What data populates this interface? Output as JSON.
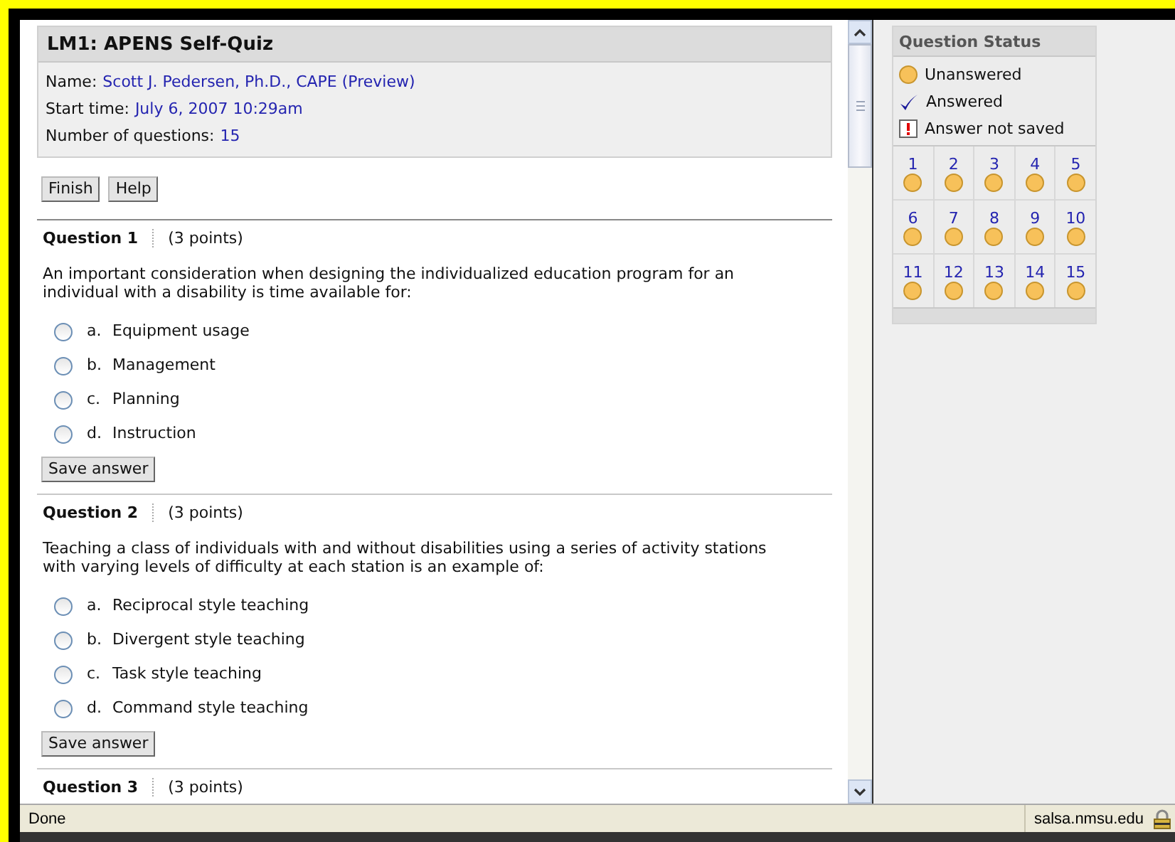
{
  "quiz": {
    "title": "LM1: APENS Self-Quiz",
    "info": [
      {
        "label": "Name:",
        "value": "Scott J. Pedersen, Ph.D., CAPE (Preview)"
      },
      {
        "label": "Start time:",
        "value": "July 6, 2007 10:29am"
      },
      {
        "label": "Number of questions:",
        "value": "15"
      }
    ],
    "buttons": [
      "Finish",
      "Help"
    ],
    "questions": [
      {
        "heading": "Question 1",
        "points": "(3 points)",
        "text": "An important consideration when designing the individualized education program for an individual with a disability is time available for:",
        "options": [
          {
            "label": "a.",
            "text": "Equipment usage",
            "selected": false
          },
          {
            "label": "b.",
            "text": "Management",
            "selected": false
          },
          {
            "label": "c.",
            "text": "Planning",
            "selected": false
          },
          {
            "label": "d.",
            "text": "Instruction",
            "selected": false
          }
        ],
        "save_button": "Save answer"
      },
      {
        "heading": "Question 2",
        "points": "(3 points)",
        "text": "Teaching a class of individuals with and without disabilities using a series of activity stations with varying levels of difficulty at each station is an example of:",
        "options": [
          {
            "label": "a.",
            "text": "Reciprocal style teaching",
            "selected": false
          },
          {
            "label": "b.",
            "text": "Divergent style teaching",
            "selected": false
          },
          {
            "label": "c.",
            "text": "Task style teaching",
            "selected": false
          },
          {
            "label": "d.",
            "text": "Command style teaching",
            "selected": false
          }
        ],
        "save_button": "Save answer"
      },
      {
        "heading": "Question 3",
        "points": "(3 points)"
      }
    ]
  },
  "question_status": {
    "title": "Question Status",
    "legend": [
      {
        "kind": "unanswered",
        "text": "Unanswered"
      },
      {
        "kind": "answered",
        "text": "Answered"
      },
      {
        "kind": "not_saved",
        "text": "Answer not saved"
      }
    ],
    "grid": [
      {
        "number": "1",
        "kind": "unanswered"
      },
      {
        "number": "2",
        "kind": "unanswered"
      },
      {
        "number": "3",
        "kind": "unanswered"
      },
      {
        "number": "4",
        "kind": "unanswered"
      },
      {
        "number": "5",
        "kind": "unanswered"
      },
      {
        "number": "6",
        "kind": "unanswered"
      },
      {
        "number": "7",
        "kind": "unanswered"
      },
      {
        "number": "8",
        "kind": "unanswered"
      },
      {
        "number": "9",
        "kind": "unanswered"
      },
      {
        "number": "10",
        "kind": "unanswered"
      },
      {
        "number": "11",
        "kind": "unanswered"
      },
      {
        "number": "12",
        "kind": "unanswered"
      },
      {
        "number": "13",
        "kind": "unanswered"
      },
      {
        "number": "14",
        "kind": "unanswered"
      },
      {
        "number": "15",
        "kind": "unanswered"
      }
    ]
  },
  "status_bar": {
    "text": "Done",
    "host": "salsa.nmsu.edu"
  }
}
